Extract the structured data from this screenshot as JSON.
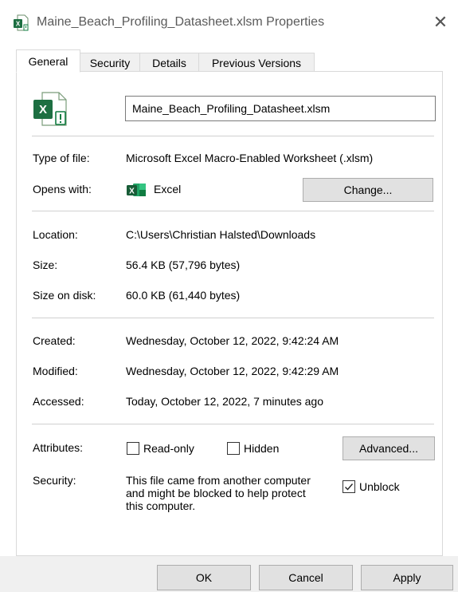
{
  "window": {
    "title": "Maine_Beach_Profiling_Datasheet.xlsm Properties",
    "close_glyph": "✕"
  },
  "tabs": [
    {
      "label": "General",
      "active": true
    },
    {
      "label": "Security",
      "active": false
    },
    {
      "label": "Details",
      "active": false
    },
    {
      "label": "Previous Versions",
      "active": false
    }
  ],
  "file": {
    "name": "Maine_Beach_Profiling_Datasheet.xlsm",
    "icon": "excel-macro-file-icon"
  },
  "info": {
    "type_label": "Type of file:",
    "type_value": "Microsoft Excel Macro-Enabled Worksheet (.xlsm)",
    "opens_label": "Opens with:",
    "opens_value": "Excel",
    "change_button": "Change...",
    "location_label": "Location:",
    "location_value": "C:\\Users\\Christian Halsted\\Downloads",
    "size_label": "Size:",
    "size_value": "56.4 KB (57,796 bytes)",
    "size_on_disk_label": "Size on disk:",
    "size_on_disk_value": "60.0 KB (61,440 bytes)",
    "created_label": "Created:",
    "created_value": "Wednesday, October 12, 2022, 9:42:24 AM",
    "modified_label": "Modified:",
    "modified_value": "Wednesday, October 12, 2022, 9:42:29 AM",
    "accessed_label": "Accessed:",
    "accessed_value": "Today, October 12, 2022, 7 minutes ago"
  },
  "attributes": {
    "label": "Attributes:",
    "readonly_label": "Read-only",
    "readonly_checked": false,
    "hidden_label": "Hidden",
    "hidden_checked": false,
    "advanced_button": "Advanced..."
  },
  "security": {
    "label": "Security:",
    "text_lines": [
      "This file came from another computer",
      "and might be blocked to help protect",
      "this computer."
    ],
    "unblock_label": "Unblock",
    "unblock_checked": true
  },
  "footer": {
    "ok": "OK",
    "cancel": "Cancel",
    "apply": "Apply"
  },
  "colors": {
    "excel_green": "#1d6f42",
    "excel_green_light": "#21a366",
    "warning_green": "#107c41"
  }
}
